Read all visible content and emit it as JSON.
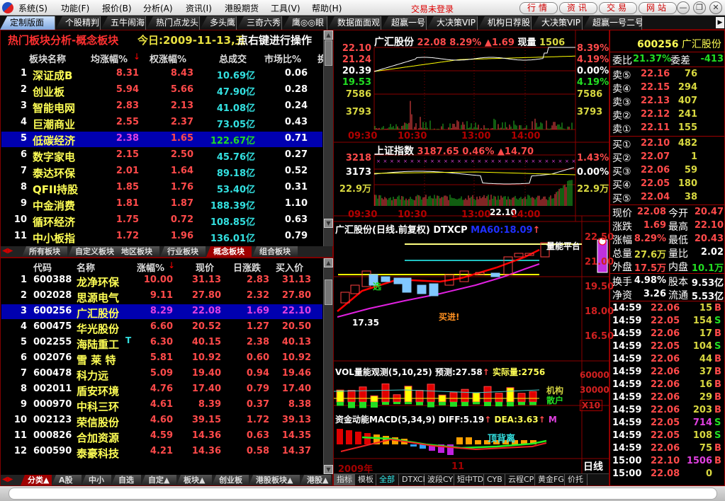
{
  "menubar": {
    "items": [
      "系统(S)",
      "功能(F)",
      "报价(B)",
      "分析(A)",
      "资讯(I)",
      "港股期货",
      "工具(V)",
      "帮助(H)"
    ],
    "status": "交易未登录",
    "buttons": [
      "行情",
      "资讯",
      "交易",
      "网站"
    ]
  },
  "tabs": [
    "定制版面",
    "个股精判",
    "五牛闹海",
    "热门点龙头",
    "多头鹰",
    "三奇六秀",
    "鹰◎◎眼",
    "数据面面观",
    "超赢一号",
    "大决策VIP",
    "机构日荐股",
    "大决策VIP",
    "超赢一号二号"
  ],
  "sector": {
    "title": "热门板块分析-概念板块",
    "date": "今日:2009-11-13,五",
    "hint": "点右键进行操作",
    "headers": [
      "板块名称",
      "均涨幅%",
      "权涨幅%",
      "总成交",
      "市场比%",
      "换"
    ],
    "rows": [
      [
        "1",
        "深证成B",
        "8.31",
        "8.43",
        "10.69亿",
        "0.06"
      ],
      [
        "2",
        "创业板",
        "5.94",
        "5.66",
        "47.90亿",
        "0.28"
      ],
      [
        "3",
        "智能电网",
        "2.83",
        "2.13",
        "41.08亿",
        "0.24"
      ],
      [
        "4",
        "巨潮商业",
        "2.55",
        "2.37",
        "73.05亿",
        "0.43"
      ],
      [
        "5",
        "低碳经济",
        "2.38",
        "1.65",
        "122.67亿",
        "0.71"
      ],
      [
        "6",
        "数字家电",
        "2.15",
        "2.50",
        "45.76亿",
        "0.27"
      ],
      [
        "7",
        "泰达环保",
        "2.01",
        "1.64",
        "89.18亿",
        "0.52"
      ],
      [
        "8",
        "QFII持股",
        "1.85",
        "1.76",
        "53.40亿",
        "0.31"
      ],
      [
        "9",
        "中金消费",
        "1.81",
        "1.87",
        "188.39亿",
        "1.10"
      ],
      [
        "10",
        "循环经济",
        "1.75",
        "0.72",
        "108.85亿",
        "0.63"
      ],
      [
        "11",
        "中小板指",
        "1.72",
        "1.96",
        "136.01亿",
        "0.79"
      ]
    ],
    "selected": 4,
    "subtabs": [
      "所有板块",
      "自定义板块",
      "地区板块",
      "行业板块",
      "概念板块",
      "组合板块"
    ],
    "active_subtab": 4
  },
  "stocks": {
    "headers": [
      "代码",
      "名称",
      "涨幅%",
      "现价",
      "日涨跌",
      "买入价"
    ],
    "rows": [
      [
        "1",
        "600388",
        "龙净环保",
        "10.00",
        "31.13",
        "2.83",
        "31.13"
      ],
      [
        "2",
        "002028",
        "思源电气",
        "9.11",
        "27.80",
        "2.32",
        "27.80"
      ],
      [
        "3",
        "600256",
        "广汇股份",
        "8.29",
        "22.08",
        "1.69",
        "22.10"
      ],
      [
        "4",
        "600475",
        "华光股份",
        "6.60",
        "20.52",
        "1.27",
        "20.50"
      ],
      [
        "5",
        "002255",
        "海陆重工",
        "6.30",
        "40.15",
        "2.38",
        "40.13"
      ],
      [
        "6",
        "002076",
        "雪 莱 特",
        "5.81",
        "10.92",
        "0.60",
        "10.92"
      ],
      [
        "7",
        "600478",
        "科力远",
        "5.09",
        "19.40",
        "0.94",
        "19.46"
      ],
      [
        "8",
        "002011",
        "盾安环境",
        "4.76",
        "17.40",
        "0.79",
        "17.40"
      ],
      [
        "9",
        "000970",
        "中科三环",
        "4.61",
        "8.39",
        "0.37",
        "8.38"
      ],
      [
        "10",
        "002123",
        "荣信股份",
        "4.60",
        "39.15",
        "1.72",
        "39.13"
      ],
      [
        "11",
        "000826",
        "合加资源",
        "4.59",
        "14.36",
        "0.63",
        "14.35"
      ],
      [
        "12",
        "600590",
        "泰豪科技",
        "4.21",
        "14.36",
        "0.58",
        "14.37"
      ]
    ],
    "selected": 2,
    "t_marker": "T",
    "bottom_tabs": [
      "分类▲",
      "A股",
      "中小",
      "自选",
      "自定▲",
      "板块▲",
      "创业板",
      "港股板块▲",
      "港股▲"
    ],
    "active_bottom_tab": 0
  },
  "intraday": {
    "name": "广汇股份",
    "price": "22.08",
    "pct": "8.29%",
    "change": "▲1.69",
    "vol_label": "现量",
    "vol": "1506",
    "left_labels": [
      "22.10",
      "21.24",
      "20.39",
      "19.53",
      "7586",
      "3793"
    ],
    "right_labels": [
      "8.39%",
      "4.19%",
      "0.00%",
      "4.19%",
      "7586",
      "3793"
    ],
    "times": [
      "09:30",
      "10:30",
      "13:00",
      "14:00"
    ]
  },
  "index": {
    "name": "上证指数",
    "price": "3187.65",
    "pct": "0.46%",
    "change": "▲14.70",
    "left_labels": [
      "3218",
      "3173",
      "22.9万"
    ],
    "right_labels": [
      "1.43%",
      "0.00%",
      "22.9万"
    ],
    "times": [
      "09:30",
      "10:30",
      "13:00",
      "14:00"
    ]
  },
  "kline": {
    "title": "广汇股份(日线.前复权) DTXCP",
    "ma": "MA60:18.09",
    "arrow": "↑",
    "price_labels": [
      "22.50",
      "21.00",
      "19.50",
      "18.00",
      "16.50"
    ],
    "ann_high": "22.10",
    "ann_low": "17.35",
    "ann_buy": "买进!",
    "ann_sell": "选",
    "ann_flat": "量能平台"
  },
  "vol": {
    "title": "VOL量能观测(5,10,25)",
    "forecast": "预测:27.58",
    "actual": "实际量:2756",
    "labels": [
      "60000",
      "30000",
      "X10"
    ],
    "legend1": "机构",
    "legend2": "散户"
  },
  "macd": {
    "title": "资金动能MACD(5,34,9)",
    "diff": "DIFF:5.19",
    "dea": "DEA:3.63",
    "m": "M",
    "ann": "顶背离"
  },
  "axis": {
    "year": "2009年",
    "month": "11",
    "period": "日线"
  },
  "indicator_tabs": [
    "指标",
    "模板",
    "全部",
    "DTXCP",
    "波段CY",
    "短中TD",
    "CYB",
    "云程CP",
    "黄金FG",
    "价托"
  ],
  "quote": {
    "code": "600256",
    "name": "广汇股份",
    "wb_label": "委比",
    "wb": "21.37%",
    "wc_label": "委差",
    "wc": "-413",
    "sell": [
      [
        "卖⑤",
        "22.16",
        "76"
      ],
      [
        "卖④",
        "22.15",
        "294"
      ],
      [
        "卖③",
        "22.13",
        "407"
      ],
      [
        "卖②",
        "22.12",
        "241"
      ],
      [
        "卖①",
        "22.11",
        "155"
      ]
    ],
    "buy": [
      [
        "买①",
        "22.10",
        "482"
      ],
      [
        "买②",
        "22.07",
        "1"
      ],
      [
        "买③",
        "22.06",
        "59"
      ],
      [
        "买④",
        "22.05",
        "180"
      ],
      [
        "买⑤",
        "22.04",
        "38"
      ]
    ],
    "stats": [
      [
        "现价",
        "22.08",
        "今开",
        "20.47"
      ],
      [
        "涨跌",
        "1.69",
        "最高",
        "22.10"
      ],
      [
        "涨幅",
        "8.29%",
        "最低",
        "20.43"
      ],
      [
        "总量",
        "27.6万",
        "量比",
        "2.02"
      ],
      [
        "外盘",
        "17.5万",
        "内盘",
        "10.1万"
      ],
      [
        "换手",
        "4.98%",
        "股本",
        "9.53亿"
      ],
      [
        "净资",
        "3.26",
        "流通",
        "5.53亿"
      ]
    ],
    "ticks": [
      [
        "14:59",
        "22.06",
        "15",
        "B"
      ],
      [
        "14:59",
        "22.05",
        "154",
        "S"
      ],
      [
        "14:59",
        "22.06",
        "17",
        "B"
      ],
      [
        "14:59",
        "22.05",
        "104",
        "S"
      ],
      [
        "14:59",
        "22.06",
        "44",
        "B"
      ],
      [
        "14:59",
        "22.06",
        "37",
        "B"
      ],
      [
        "14:59",
        "22.06",
        "16",
        "B"
      ],
      [
        "14:59",
        "22.06",
        "29",
        "B"
      ],
      [
        "14:59",
        "22.06",
        "203",
        "B"
      ],
      [
        "14:59",
        "22.05",
        "714",
        "S"
      ],
      [
        "14:59",
        "22.05",
        "108",
        "S"
      ],
      [
        "14:59",
        "22.06",
        "75",
        "B"
      ],
      [
        "15:00",
        "22.10",
        "1506",
        "B"
      ],
      [
        "15:00",
        "22.08",
        "0",
        ""
      ]
    ]
  },
  "command_input": {
    "value": ""
  },
  "colors": {
    "up": "#ff4a4a",
    "down": "#22dd22",
    "name": "#ffff55",
    "amount": "#33e0e0",
    "selected_row": "#0000b0",
    "border": "#800000"
  }
}
